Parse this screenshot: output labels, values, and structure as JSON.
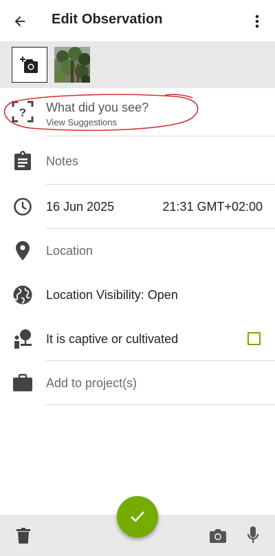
{
  "header": {
    "title": "Edit Observation",
    "back_icon": "arrow-back-icon",
    "menu_icon": "more-vert-icon"
  },
  "photos": {
    "add_icon": "add-photo-camera-icon",
    "thumbnail": "photo-thumbnail-tree"
  },
  "form": {
    "species_title": "What did you see?",
    "species_subtitle": "View Suggestions",
    "notes_placeholder": "Notes",
    "date": "16 Jun 2025",
    "time": "21:31 GMT+02:00",
    "location_placeholder": "Location",
    "location_visibility": "Location Visibility: Open",
    "captive_label": "It is captive or cultivated",
    "captive_checked": false,
    "projects_placeholder": "Add to project(s)"
  },
  "footer": {
    "delete_icon": "trash-icon",
    "save_icon": "check-icon",
    "camera_icon": "camera-icon",
    "mic_icon": "microphone-icon"
  },
  "colors": {
    "accent": "#74ac00",
    "annotation": "#d32f2f",
    "icon": "#555555"
  }
}
